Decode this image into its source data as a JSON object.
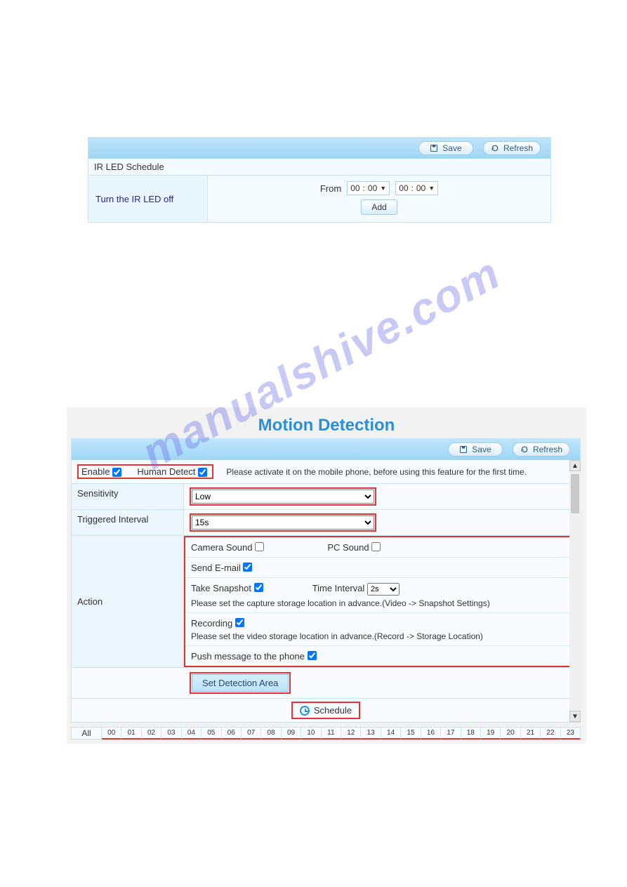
{
  "panel_a": {
    "buttons": {
      "save": "Save",
      "refresh": "Refresh"
    },
    "section_title": "IR LED Schedule",
    "row_label": "Turn the IR LED off",
    "from_label": "From",
    "time1_h": "00",
    "time1_m": "00",
    "time2_h": "00",
    "time2_m": "00",
    "add_label": "Add"
  },
  "watermark": "manualshive.com",
  "panel_b": {
    "title": "Motion Detection",
    "buttons": {
      "save": "Save",
      "refresh": "Refresh"
    },
    "enable_label": "Enable",
    "human_label": "Human Detect",
    "activate_note": "Please activate it on the mobile phone, before using this feature for the first time.",
    "sensitivity_label": "Sensitivity",
    "sensitivity_value": "Low",
    "trigint_label": "Triggered Interval",
    "trigint_value": "15s",
    "action_label": "Action",
    "camera_sound": "Camera Sound",
    "pc_sound": "PC Sound",
    "send_email": "Send E-mail",
    "take_snapshot": "Take Snapshot",
    "time_interval_label": "Time Interval",
    "time_interval_value": "2s",
    "snapshot_hint": "Please set the capture storage location in advance.(Video -> Snapshot Settings)",
    "recording": "Recording",
    "recording_hint": "Please set the video storage location in advance.(Record -> Storage Location)",
    "push_msg": "Push message to the phone",
    "set_area": "Set Detection Area",
    "schedule_label": "Schedule",
    "all_label": "All",
    "hours": [
      "00",
      "01",
      "02",
      "03",
      "04",
      "05",
      "06",
      "07",
      "08",
      "09",
      "10",
      "11",
      "12",
      "13",
      "14",
      "15",
      "16",
      "17",
      "18",
      "19",
      "20",
      "21",
      "22",
      "23"
    ]
  }
}
